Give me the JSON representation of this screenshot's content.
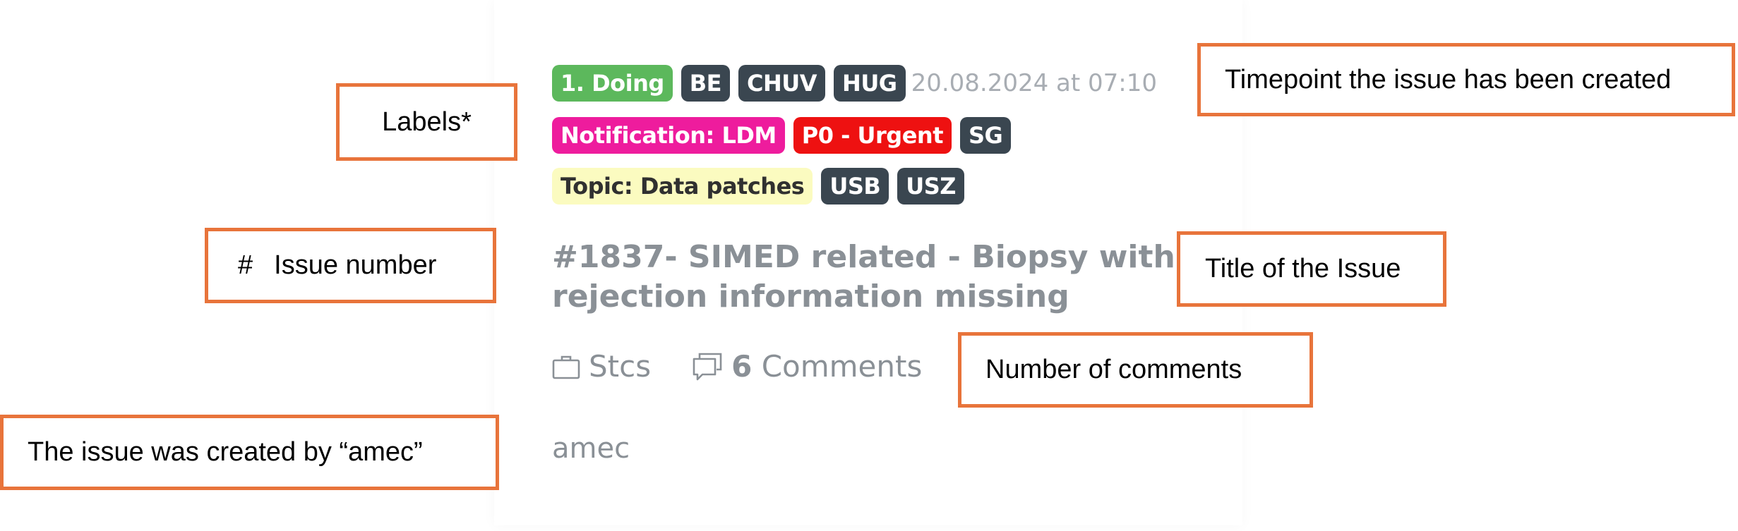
{
  "issue": {
    "labels_row1": [
      "1. Doing",
      "BE",
      "CHUV",
      "HUG"
    ],
    "timestamp": "20.08.2024 at 07:10",
    "labels_row2": [
      "Notification: LDM",
      "P0 - Urgent",
      "SG"
    ],
    "labels_row3": [
      "Topic: Data patches",
      "USB",
      "USZ"
    ],
    "title_line1": "#1837- SIMED related - Biopsy with",
    "title_line2": "rejection information missing",
    "project": "Stcs",
    "comment_count": "6",
    "comment_label": "Comments",
    "author": "amec"
  },
  "annotations": {
    "labels": "Labels*",
    "timepoint": "Timepoint the issue has been created",
    "issue_number_hash": "#",
    "issue_number": "Issue number",
    "title": "Title of the Issue",
    "comments": "Number of comments",
    "author": "The issue was created by “amec”"
  },
  "colors": {
    "annotation_border": "#e8743b",
    "label_doing": "#5cb85c",
    "label_dark": "#3a4650",
    "label_notification": "#ee1c9d",
    "label_urgent": "#ee1111",
    "label_topic": "#fbfbc0",
    "muted_text": "#8a9096"
  },
  "icons": {
    "project": "briefcase-icon",
    "comments": "comment-bubbles-icon"
  }
}
